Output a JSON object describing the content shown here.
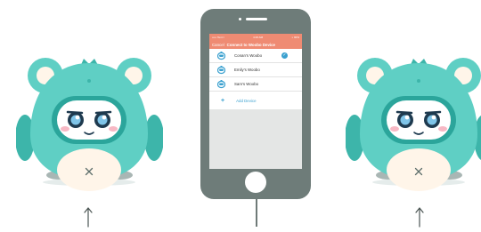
{
  "phone": {
    "status_bar": {
      "carrier": "••••• Text ≈",
      "time": "4:26 AM",
      "battery": "◗ 90%"
    },
    "nav": {
      "cancel_label": "Cancel",
      "title": "Connect to Woobo Device"
    },
    "devices": [
      {
        "name": "Conan's Woobo",
        "connected": true
      },
      {
        "name": "Emily's Woobo",
        "connected": false
      },
      {
        "name": "Sam's Woobo",
        "connected": false
      }
    ],
    "add_device_label": "Add Device",
    "check_mark": "✓"
  },
  "arrows": {
    "left": "↑",
    "right": "↑"
  },
  "colors": {
    "accent": "#ef8b73",
    "link": "#3aa0cf",
    "robot_body": "#5fcfc4",
    "robot_dark": "#3db5aa",
    "phone_body": "#6e7c79"
  }
}
